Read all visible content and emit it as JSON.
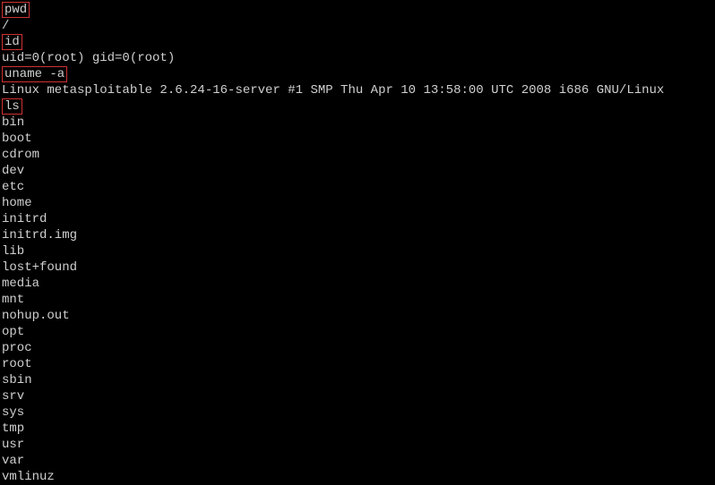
{
  "terminal": {
    "lines": [
      {
        "type": "command",
        "text": "pwd"
      },
      {
        "type": "output",
        "text": "/"
      },
      {
        "type": "command",
        "text": "id"
      },
      {
        "type": "output",
        "text": "uid=0(root) gid=0(root)"
      },
      {
        "type": "command",
        "text": "uname -a"
      },
      {
        "type": "output",
        "text": "Linux metasploitable 2.6.24-16-server #1 SMP Thu Apr 10 13:58:00 UTC 2008 i686 GNU/Linux"
      },
      {
        "type": "command",
        "text": "ls"
      },
      {
        "type": "output",
        "text": "bin"
      },
      {
        "type": "output",
        "text": "boot"
      },
      {
        "type": "output",
        "text": "cdrom"
      },
      {
        "type": "output",
        "text": "dev"
      },
      {
        "type": "output",
        "text": "etc"
      },
      {
        "type": "output",
        "text": "home"
      },
      {
        "type": "output",
        "text": "initrd"
      },
      {
        "type": "output",
        "text": "initrd.img"
      },
      {
        "type": "output",
        "text": "lib"
      },
      {
        "type": "output",
        "text": "lost+found"
      },
      {
        "type": "output",
        "text": "media"
      },
      {
        "type": "output",
        "text": "mnt"
      },
      {
        "type": "output",
        "text": "nohup.out"
      },
      {
        "type": "output",
        "text": "opt"
      },
      {
        "type": "output",
        "text": "proc"
      },
      {
        "type": "output",
        "text": "root"
      },
      {
        "type": "output",
        "text": "sbin"
      },
      {
        "type": "output",
        "text": "srv"
      },
      {
        "type": "output",
        "text": "sys"
      },
      {
        "type": "output",
        "text": "tmp"
      },
      {
        "type": "output",
        "text": "usr"
      },
      {
        "type": "output",
        "text": "var"
      },
      {
        "type": "output",
        "text": "vmlinuz"
      }
    ]
  }
}
